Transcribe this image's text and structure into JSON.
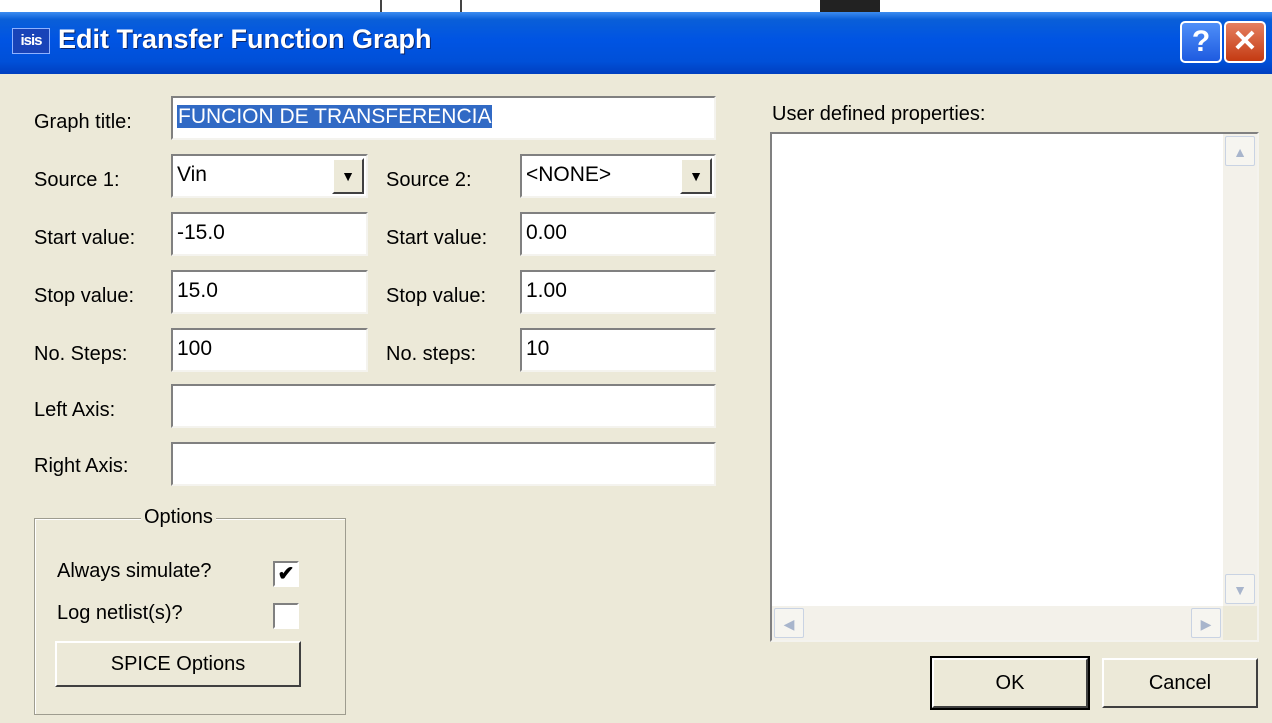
{
  "window": {
    "title": "Edit Transfer Function Graph",
    "app_icon_text": "isis",
    "help_label": "?",
    "close_label": "✕"
  },
  "form": {
    "graph_title": {
      "label": "Graph title:",
      "value": "FUNCION DE TRANSFERENCIA"
    },
    "source1": {
      "label": "Source 1:",
      "value": "Vin"
    },
    "source2": {
      "label": "Source 2:",
      "value": "<NONE>"
    },
    "start_value_1": {
      "label": "Start value:",
      "value": "-15.0"
    },
    "start_value_2": {
      "label": "Start value:",
      "value": "0.00"
    },
    "stop_value_1": {
      "label": "Stop value:",
      "value": "15.0"
    },
    "stop_value_2": {
      "label": "Stop value:",
      "value": "1.00"
    },
    "steps_1": {
      "label": "No. Steps:",
      "value": "100"
    },
    "steps_2": {
      "label": "No. steps:",
      "value": "10"
    },
    "left_axis": {
      "label": "Left Axis:",
      "value": ""
    },
    "right_axis": {
      "label": "Right Axis:",
      "value": ""
    }
  },
  "options": {
    "legend": "Options",
    "always_simulate": {
      "label": "Always simulate?",
      "checked": true,
      "mark": "✔"
    },
    "log_netlist": {
      "label": "Log netlist(s)?",
      "checked": false,
      "mark": ""
    },
    "spice_button": "SPICE Options"
  },
  "user_props": {
    "label": "User defined properties:",
    "value": ""
  },
  "buttons": {
    "ok": "OK",
    "cancel": "Cancel"
  }
}
